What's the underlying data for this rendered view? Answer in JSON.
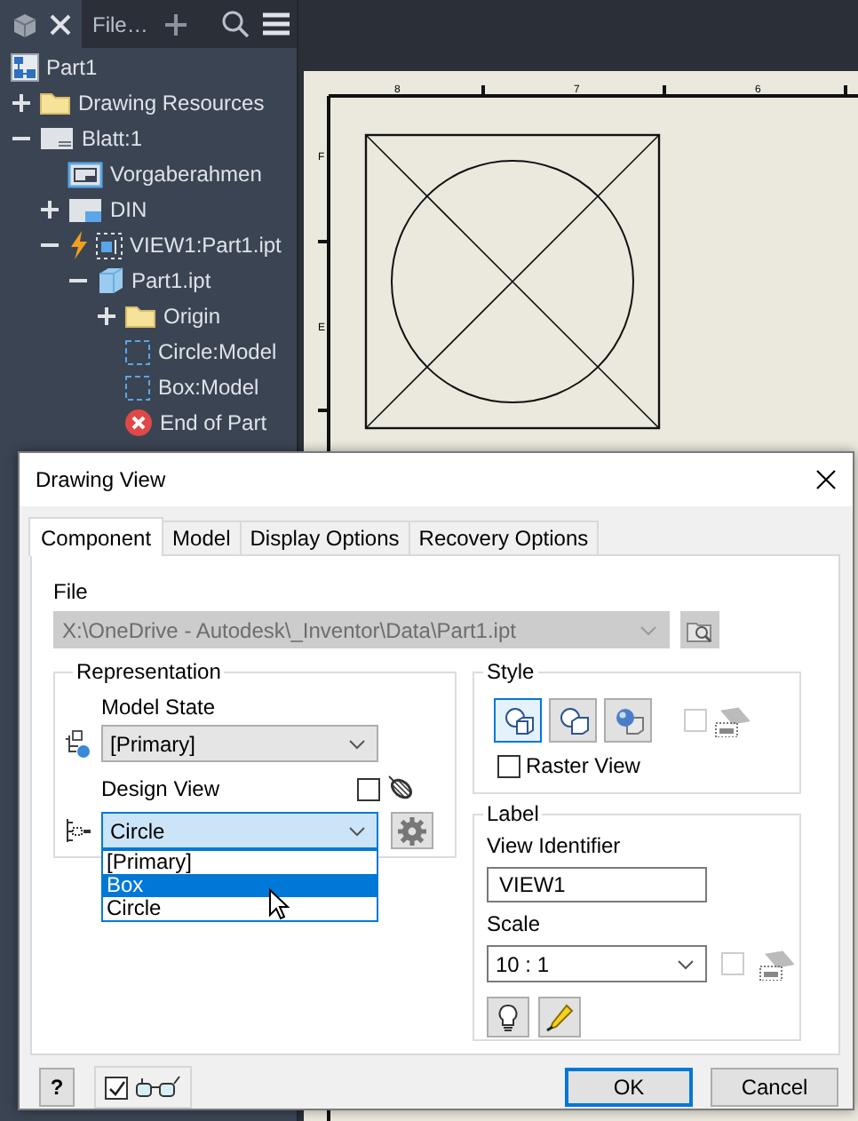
{
  "browser": {
    "tabs": [
      {
        "kind": "model",
        "selected": true,
        "closable": true
      },
      {
        "kind": "file",
        "label": "File…",
        "selected": false,
        "closable": false
      }
    ],
    "tree": [
      {
        "kind": "part",
        "label": "Part1",
        "children": [
          {
            "kind": "folder",
            "label": "Drawing Resources",
            "expanded": false
          },
          {
            "kind": "sheet",
            "label": "Blatt:1",
            "expanded": true,
            "children": [
              {
                "kind": "border",
                "label": "Vorgaberahmen"
              },
              {
                "kind": "titleblock",
                "label": "DIN",
                "expanded": false
              },
              {
                "kind": "view",
                "label": "VIEW1:Part1.ipt",
                "expanded": true,
                "children": [
                  {
                    "kind": "partfile",
                    "label": "Part1.ipt",
                    "expanded": true,
                    "children": [
                      {
                        "kind": "folder",
                        "label": "Origin",
                        "expanded": false
                      },
                      {
                        "kind": "sketch",
                        "label": "Circle:Model"
                      },
                      {
                        "kind": "sketch",
                        "label": "Box:Model"
                      },
                      {
                        "kind": "end",
                        "label": "End of Part"
                      }
                    ]
                  }
                ]
              }
            ]
          }
        ]
      }
    ]
  },
  "sheet": {
    "column_marks": [
      "8",
      "7",
      "6"
    ],
    "row_marks": [
      "F",
      "E"
    ]
  },
  "dialog": {
    "title": "Drawing View",
    "tabs": [
      {
        "label": "Component",
        "selected": true
      },
      {
        "label": "Model",
        "selected": false
      },
      {
        "label": "Display Options",
        "selected": false
      },
      {
        "label": "Recovery Options",
        "selected": false
      }
    ],
    "file": {
      "label": "File",
      "value": "X:\\OneDrive - Autodesk\\_Inventor\\Data\\Part1.ipt",
      "disabled": true
    },
    "representation": {
      "title": "Representation",
      "model_state": {
        "label": "Model State",
        "value": "[Primary]"
      },
      "design_view": {
        "label": "Design View",
        "checked": false,
        "value": "Circle",
        "expanded": true,
        "options": [
          {
            "label": "[Primary]",
            "highlighted": false
          },
          {
            "label": "Box",
            "highlighted": true
          },
          {
            "label": "Circle",
            "highlighted": false
          }
        ]
      }
    },
    "style": {
      "title": "Style",
      "modes": [
        {
          "kind": "hidden-line",
          "selected": true
        },
        {
          "kind": "hidden-line-removed",
          "selected": false
        },
        {
          "kind": "shaded",
          "selected": false
        }
      ],
      "from_base": {
        "checked": false,
        "disabled": true
      },
      "raster_view": {
        "label": "Raster View",
        "checked": false
      }
    },
    "label": {
      "title": "Label",
      "view_identifier": {
        "label": "View Identifier",
        "value": "VIEW1"
      },
      "scale": {
        "label": "Scale",
        "value": "10 : 1"
      },
      "from_base": {
        "checked": false,
        "disabled": true
      }
    },
    "help_button": "?",
    "preview": {
      "checked": true
    },
    "buttons": [
      {
        "label": "OK",
        "default": true
      },
      {
        "label": "Cancel",
        "default": false
      }
    ]
  }
}
